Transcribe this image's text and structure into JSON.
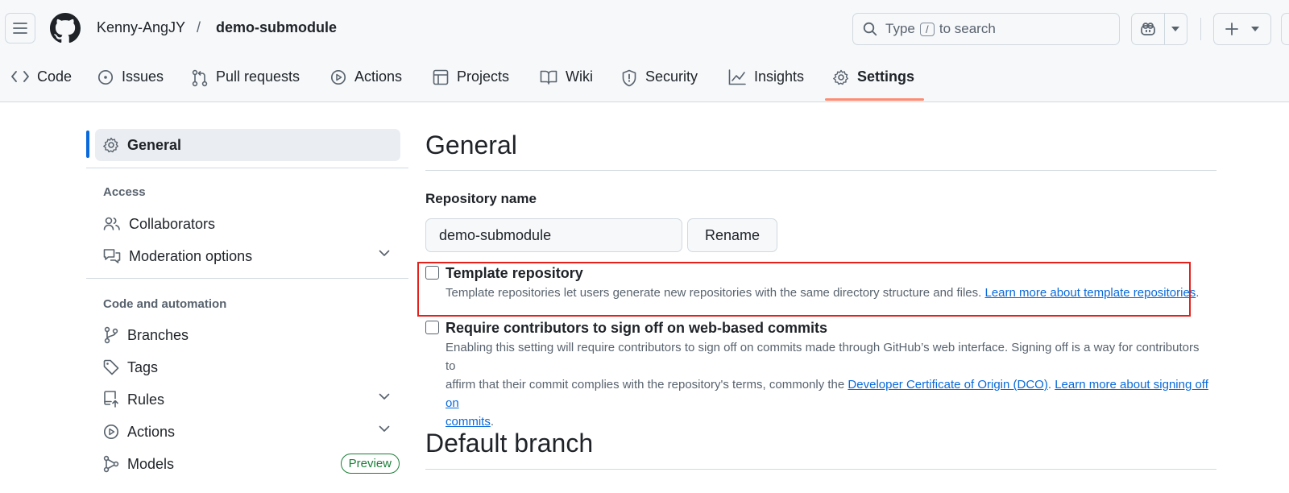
{
  "header": {
    "owner": "Kenny-AngJY",
    "separator": "/",
    "repo": "demo-submodule",
    "search": {
      "prefix": "Type",
      "key": "/",
      "suffix": "to search"
    }
  },
  "tabs": [
    {
      "label": "Code",
      "icon": "code-icon"
    },
    {
      "label": "Issues",
      "icon": "issue-opened-icon"
    },
    {
      "label": "Pull requests",
      "icon": "git-pull-request-icon"
    },
    {
      "label": "Actions",
      "icon": "play-icon"
    },
    {
      "label": "Projects",
      "icon": "table-icon"
    },
    {
      "label": "Wiki",
      "icon": "book-icon"
    },
    {
      "label": "Security",
      "icon": "shield-icon"
    },
    {
      "label": "Insights",
      "icon": "graph-icon"
    },
    {
      "label": "Settings",
      "icon": "gear-icon",
      "active": true
    }
  ],
  "sidebar": {
    "general": "General",
    "access_heading": "Access",
    "access_items": [
      {
        "label": "Collaborators",
        "icon": "people-icon"
      },
      {
        "label": "Moderation options",
        "icon": "comment-discussion-icon",
        "expandable": true
      }
    ],
    "code_heading": "Code and automation",
    "code_items": [
      {
        "label": "Branches",
        "icon": "git-branch-icon"
      },
      {
        "label": "Tags",
        "icon": "tag-icon"
      },
      {
        "label": "Rules",
        "icon": "repo-push-icon",
        "expandable": true
      },
      {
        "label": "Actions",
        "icon": "play-icon",
        "expandable": true
      },
      {
        "label": "Models",
        "icon": "ai-model-icon",
        "badge": "Preview"
      }
    ]
  },
  "main": {
    "title": "General",
    "repo_name_label": "Repository name",
    "repo_name_value": "demo-submodule",
    "rename_label": "Rename",
    "template": {
      "title": "Template repository",
      "desc": "Template repositories let users generate new repositories with the same directory structure and files.",
      "link": "Learn more about template repositories",
      "end": "."
    },
    "signoff": {
      "title": "Require contributors to sign off on web-based commits",
      "line1": "Enabling this setting will require contributors to sign off on commits made through GitHub’s web interface. Signing off is a way for contributors to",
      "line2_pre": "affirm that their commit complies with the repository's terms, commonly the",
      "dco_link": "Developer Certificate of Origin (DCO)",
      "mid": ".",
      "learn_link_a": "Learn more about signing off on",
      "learn_link_b": "commits",
      "end": "."
    },
    "default_branch_title": "Default branch"
  },
  "colors": {
    "accent": "#0969da",
    "tab_underline": "#fd8c73",
    "highlight": "#e5211c",
    "badge_green": "#1a7f37"
  }
}
